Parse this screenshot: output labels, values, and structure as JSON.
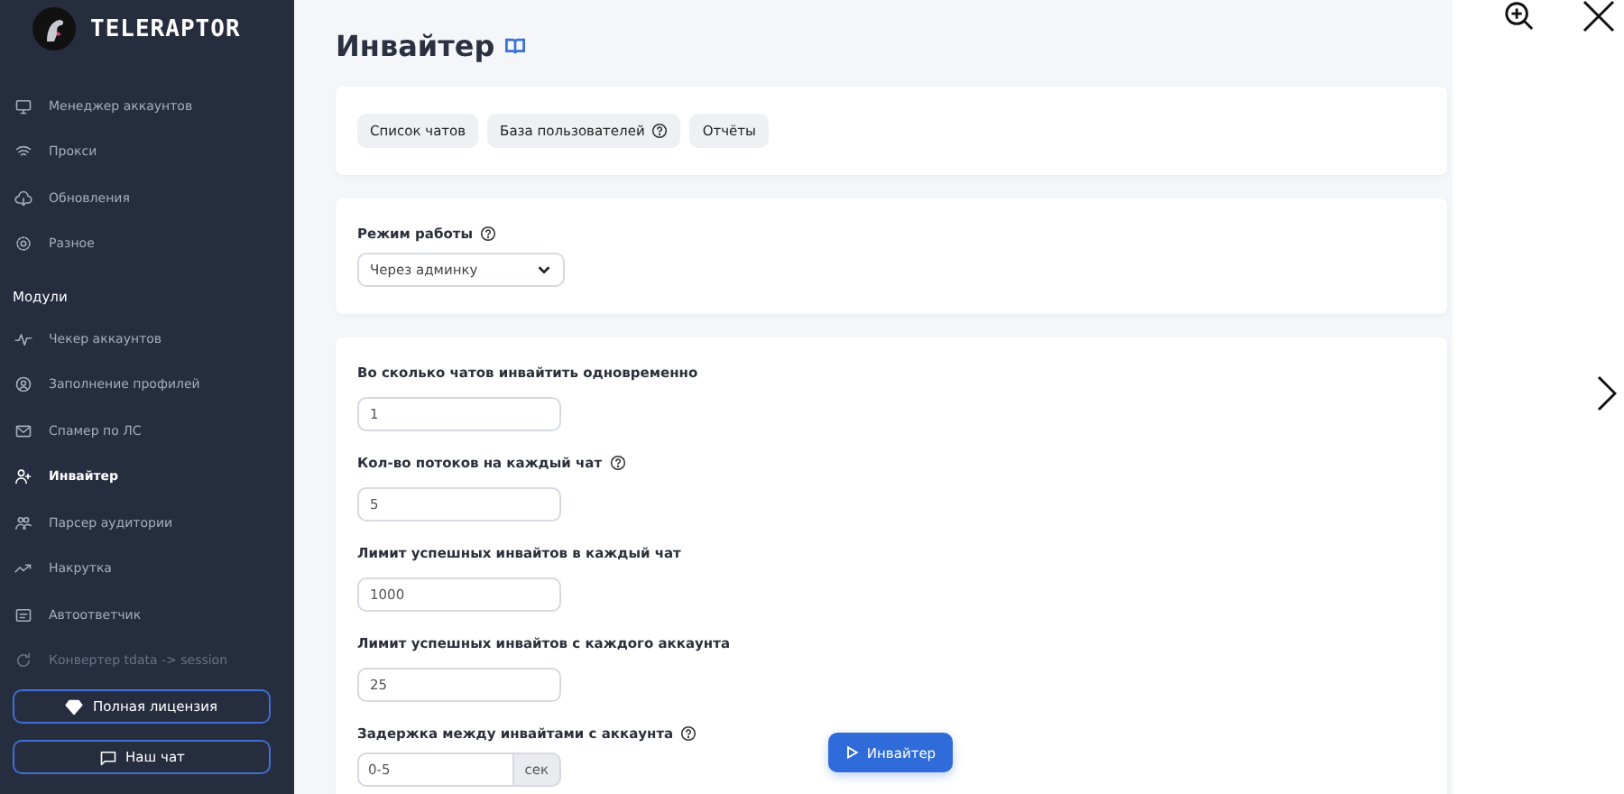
{
  "sidebar": {
    "brand": "TELERAPTOR",
    "items": [
      {
        "label": "Менеджер аккаунтов",
        "selected": false,
        "faded": false
      },
      {
        "label": "Прокси",
        "selected": false,
        "faded": false
      },
      {
        "label": "Обновления",
        "selected": false,
        "faded": false
      },
      {
        "label": "Разное",
        "selected": false,
        "faded": false
      }
    ],
    "section": "Модули",
    "modules": [
      {
        "label": "Чекер аккаунтов",
        "selected": false,
        "faded": false
      },
      {
        "label": "Заполнение профилей",
        "selected": false,
        "faded": false
      },
      {
        "label": "Спамер по ЛС",
        "selected": false,
        "faded": false
      },
      {
        "label": "Инвайтер",
        "selected": true,
        "faded": false
      },
      {
        "label": "Парсер аудитории",
        "selected": false,
        "faded": false
      },
      {
        "label": "Накрутка",
        "selected": false,
        "faded": false
      },
      {
        "label": "Автоответчик",
        "selected": false,
        "faded": false
      },
      {
        "label": "Конвертер tdata -> session",
        "selected": false,
        "faded": true
      }
    ],
    "buttons": [
      {
        "label": "Полная лицензия"
      },
      {
        "label": "Наш чат"
      }
    ]
  },
  "page": {
    "title": "Инвайтер",
    "tabs": [
      {
        "label": "Список чатов",
        "help": false
      },
      {
        "label": "База пользователей",
        "help": true
      },
      {
        "label": "Отчёты",
        "help": false
      }
    ],
    "mode": {
      "label": "Режим работы",
      "help": true,
      "value": "Через админку"
    },
    "fields": [
      {
        "label": "Во сколько чатов инвайтить одновременно",
        "help": false,
        "value": "1"
      },
      {
        "label": "Кол-во потоков на каждый чат",
        "help": true,
        "value": "5"
      },
      {
        "label": "Лимит успешных инвайтов в каждый чат",
        "help": false,
        "value": "1000"
      },
      {
        "label": "Лимит успешных инвайтов с каждого аккаунта",
        "help": false,
        "value": "25"
      },
      {
        "label": "Задержка между инвайтами с аккаунта",
        "help": true,
        "value": "0-5",
        "unit": "сек"
      }
    ],
    "run_button": "Инвайтер"
  }
}
